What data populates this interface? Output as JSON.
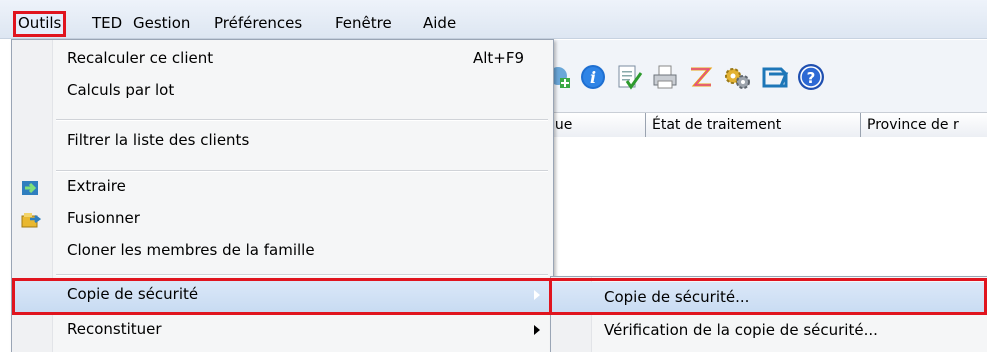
{
  "menubar": {
    "items": [
      {
        "label": "Outils",
        "highlighted": true
      },
      {
        "label": "TED"
      },
      {
        "label": "Gestion"
      },
      {
        "label": "Préférences"
      },
      {
        "label": "Fenêtre"
      },
      {
        "label": "Aide"
      }
    ]
  },
  "tools_menu": {
    "recalc_label": "Recalculer ce client",
    "recalc_shortcut": "Alt+F9",
    "batch_label": "Calculs par lot",
    "filter_label": "Filtrer la liste des clients",
    "extract_label": "Extraire",
    "merge_label": "Fusionner",
    "clone_label": "Cloner les membres de la famille",
    "backup_label": "Copie de sécurité",
    "rebuild_label": "Reconstituer"
  },
  "backup_submenu": {
    "backup_label": "Copie de sécurité...",
    "verify_label": "Vérification de la copie de sécurité..."
  },
  "grid": {
    "columns": [
      "gue",
      "État de traitement",
      "Province de r"
    ]
  },
  "toolbar_icons": [
    "add-client-icon",
    "info-icon",
    "checklist-icon",
    "print-icon",
    "transmit-icon",
    "settings-icon",
    "folder-icon",
    "help-icon"
  ],
  "colors": {
    "highlight_red": "#e0141e",
    "menu_selection": "#c8dbf2"
  }
}
